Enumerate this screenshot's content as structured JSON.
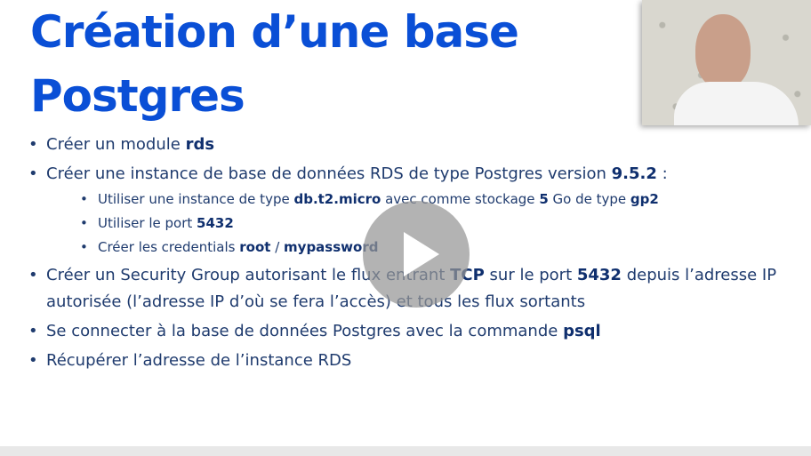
{
  "slide": {
    "title_line1": "Création d’une base",
    "title_line2": "Postgres",
    "b1": {
      "pre": "Créer un module ",
      "bold": "rds"
    },
    "b2": {
      "pre": "Créer une instance de base de données RDS de type Postgres version ",
      "bold": "9.5.2",
      "post": " :",
      "sub1": {
        "pre": "Utiliser une instance de type ",
        "bold1": "db.t2.micro",
        "mid1": " avec comme stockage ",
        "bold2": "5",
        "mid2": " Go de type ",
        "bold3": "gp2"
      },
      "sub2": {
        "pre": "Utiliser le port ",
        "bold": "5432"
      },
      "sub3": {
        "pre": "Créer les credentials ",
        "bold1": "root",
        "mid": " / ",
        "bold2": "mypassword"
      }
    },
    "b3": {
      "pre": "Créer un Security Group autorisant le flux entrant ",
      "bold1": "TCP",
      "mid": " sur le port ",
      "bold2": "5432",
      "post": " depuis l’adresse IP autorisée (l’adresse IP d’où se fera l’accès) et tous les flux sortants"
    },
    "b4": {
      "pre": "Se connecter à la base de données Postgres avec la commande ",
      "bold": "psql"
    },
    "b5": {
      "text": "Récupérer l’adresse de l’instance RDS"
    }
  },
  "video": {
    "play_icon": "play-icon",
    "webcam": "presenter-webcam"
  },
  "colors": {
    "title": "#0a4fd6",
    "text": "#1f3b6e"
  }
}
